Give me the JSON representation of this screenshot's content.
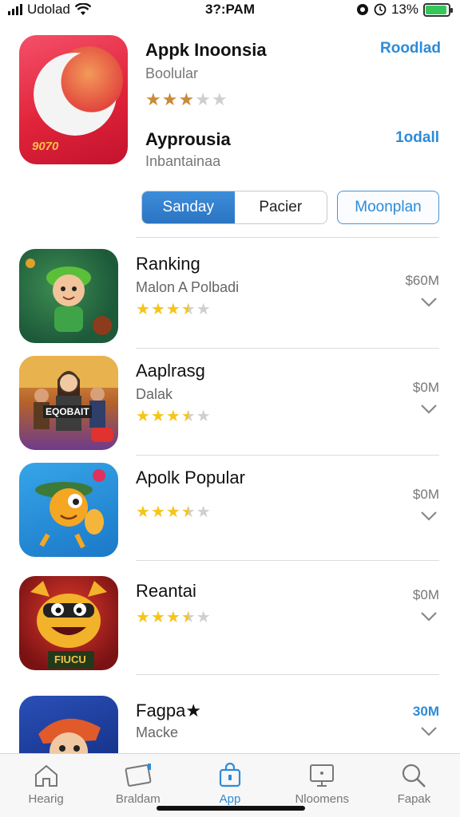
{
  "status": {
    "carrier": "Udolad",
    "time": "3?:PAM",
    "battery": "13%",
    "battery_level": 0.93
  },
  "featured": {
    "title": "Appk Inoonsia",
    "subtitle": "Boolular",
    "rating": 3,
    "action": "Roodlad",
    "icon_mark": "9070",
    "title2": "Ayprousia",
    "subtitle2": "Inbantainaa",
    "action2": "1odall",
    "segments": [
      "Sanday",
      "Pacier"
    ],
    "active_segment": 0,
    "outline_button": "Moonplan"
  },
  "apps": [
    {
      "title": "Ranking",
      "subtitle": "Malon A Polbadi",
      "price": "$60M",
      "rating": 3.5,
      "icon": "cartoon-boy-icon"
    },
    {
      "title": "Aaplrasg",
      "subtitle": "Dalak",
      "price": "$0M",
      "rating": 3.5,
      "icon": "group-poster-icon",
      "icon_text": "EQOBAIT"
    },
    {
      "title": "Apolk Popular",
      "subtitle": "",
      "price": "$0M",
      "rating": 3.5,
      "icon": "cartoon-character-icon"
    },
    {
      "title": "Reantai",
      "subtitle": "",
      "price": "$0M",
      "rating": 3.5,
      "icon": "monster-face-icon",
      "icon_text": "FIUCU"
    },
    {
      "title": "Fagpa★",
      "subtitle": "Macke",
      "price": "30M",
      "rating": 0,
      "icon": "hero-icon"
    }
  ],
  "tabs": [
    {
      "label": "Hearig",
      "icon": "home-icon"
    },
    {
      "label": "Braldam",
      "icon": "tablet-icon"
    },
    {
      "label": "App",
      "icon": "bag-icon"
    },
    {
      "label": "Nloomens",
      "icon": "monitor-icon"
    },
    {
      "label": "Fapak",
      "icon": "search-icon"
    }
  ],
  "active_tab": 2,
  "colors": {
    "accent": "#2c8bd8",
    "star": "#f5c518",
    "star_empty": "#cfcfcf",
    "featured_star": "#c98a3a"
  }
}
